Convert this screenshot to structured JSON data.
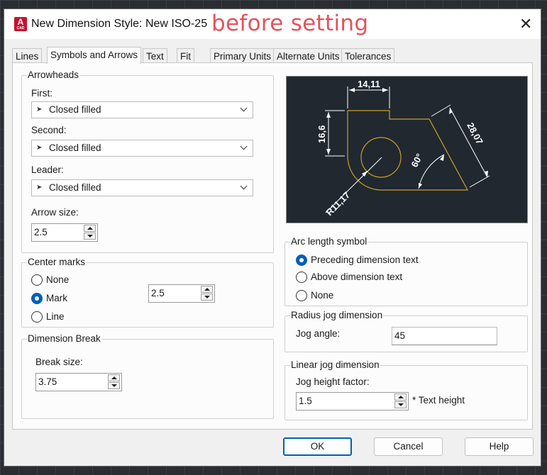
{
  "window": {
    "title": "New Dimension Style: New ISO-25",
    "annotation": "before setting",
    "app_icon_letter": "A",
    "app_icon_caption": "CAD"
  },
  "tabs": [
    "Lines",
    "Symbols and Arrows",
    "Text",
    "Fit",
    "Primary Units",
    "Alternate Units",
    "Tolerances"
  ],
  "active_tab": "Symbols and Arrows",
  "arrowheads": {
    "title": "Arrowheads",
    "first_label": "First:",
    "first_value": "Closed filled",
    "second_label": "Second:",
    "second_value": "Closed filled",
    "leader_label": "Leader:",
    "leader_value": "Closed filled",
    "arrow_size_label": "Arrow size:",
    "arrow_size_value": "2.5"
  },
  "center_marks": {
    "title": "Center marks",
    "options": [
      "None",
      "Mark",
      "Line"
    ],
    "selected": "Mark",
    "size_value": "2.5"
  },
  "dimension_break": {
    "title": "Dimension Break",
    "break_size_label": "Break size:",
    "break_size_value": "3.75"
  },
  "preview": {
    "dim_top": "14,11",
    "dim_left": "16,6",
    "dim_right": "28,07",
    "dim_angle": "60°",
    "dim_radius": "R11,17",
    "colors": {
      "background": "#212830",
      "geometry": "#c9a227",
      "dimension": "#ffffff"
    }
  },
  "arc_length": {
    "title": "Arc length symbol",
    "options": [
      "Preceding dimension text",
      "Above dimension text",
      "None"
    ],
    "selected": "Preceding dimension text"
  },
  "radius_jog": {
    "title": "Radius jog dimension",
    "jog_angle_label": "Jog angle:",
    "jog_angle_value": "45"
  },
  "linear_jog": {
    "title": "Linear jog dimension",
    "factor_label": "Jog height factor:",
    "factor_value": "1.5",
    "suffix": "* Text height"
  },
  "buttons": {
    "ok": "OK",
    "cancel": "Cancel",
    "help": "Help"
  },
  "colors": {
    "accent": "#005fb8",
    "annotation": "#e5525a"
  }
}
